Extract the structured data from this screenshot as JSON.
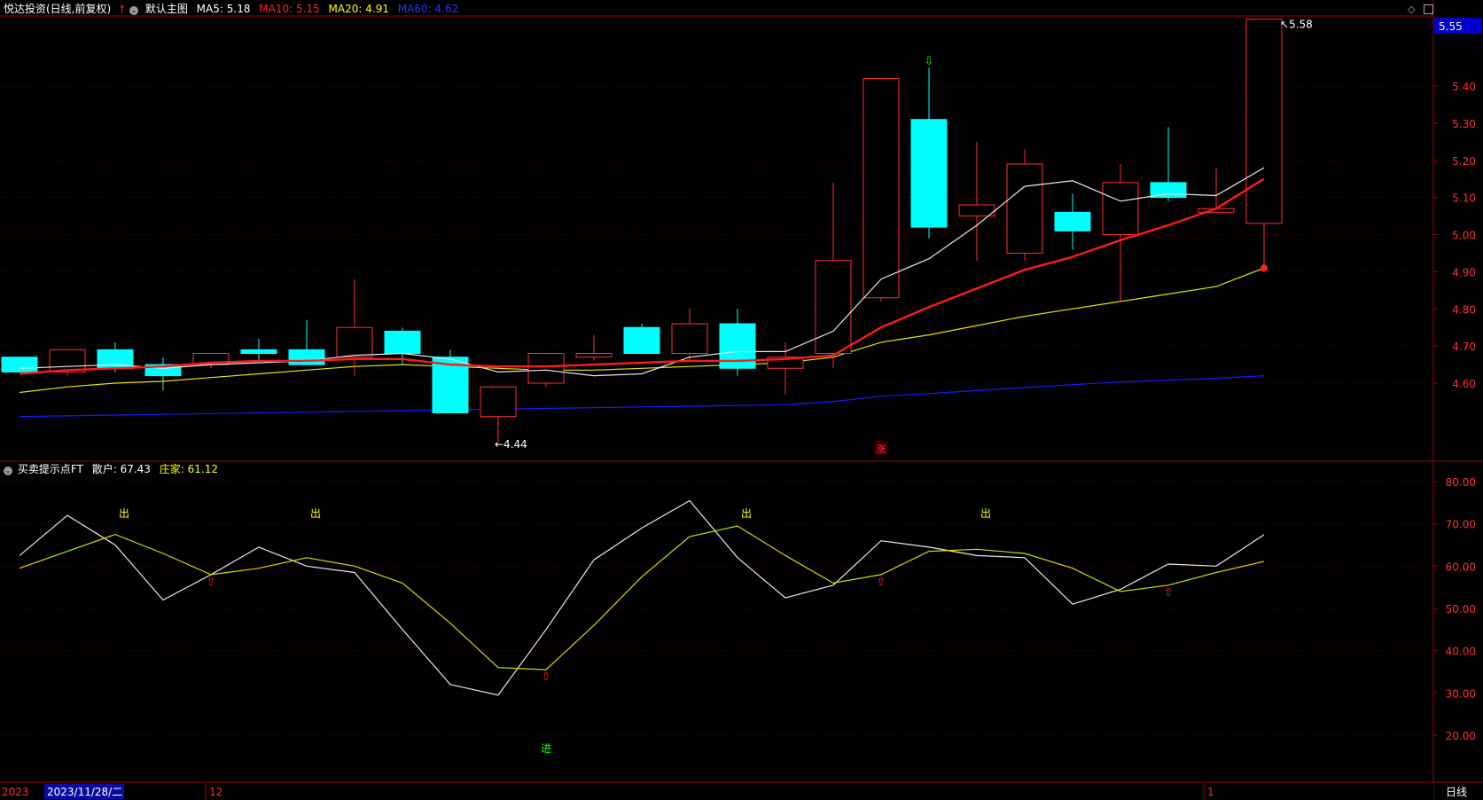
{
  "main_header": {
    "title": "悦达投资(日线,前复权)",
    "template": "默认主图",
    "ma5": {
      "label": "MA5:",
      "value": "5.18",
      "color": "#ffffff"
    },
    "ma10": {
      "label": "MA10:",
      "value": "5.15",
      "color": "#ff2020"
    },
    "ma20": {
      "label": "MA20:",
      "value": "4.91",
      "color": "#ffff00"
    },
    "ma60": {
      "label": "MA60:",
      "value": "4.62",
      "color": "#2020ff"
    }
  },
  "sub_header": {
    "title": "买卖提示点FT",
    "sanhu": {
      "label": "散户:",
      "value": "67.43",
      "color": "#ffffff"
    },
    "zhuangjia": {
      "label": "庄家:",
      "value": "61.12",
      "color": "#ffff00"
    }
  },
  "price_axis": {
    "current": "5.55",
    "ticks": [
      "5.40",
      "5.30",
      "5.20",
      "5.10",
      "5.00",
      "4.90",
      "4.80",
      "4.70",
      "4.60"
    ]
  },
  "indicator_axis": {
    "ticks": [
      "80.00",
      "70.00",
      "60.00",
      "50.00",
      "40.00",
      "30.00",
      "20.00"
    ]
  },
  "annotations": {
    "high": "5.58",
    "low": "4.44",
    "zhang": "涨",
    "chu": "出",
    "jin": "进"
  },
  "bottom_bar": {
    "year": "2023",
    "cursor_date": "2023/11/28/二",
    "month_12": "12",
    "month_1": "1",
    "period": "日线"
  },
  "colors": {
    "up": "#ff3030",
    "down": "#00ffff",
    "grid": "#800000",
    "axis_text": "#ff3030"
  },
  "chart_data": [
    {
      "type": "candlestick",
      "title": "悦达投资(日线,前复权)",
      "y_range": [
        4.4,
        5.6
      ],
      "candles": [
        {
          "o": 4.67,
          "h": 4.67,
          "l": 4.63,
          "c": 4.63
        },
        {
          "o": 4.63,
          "h": 4.69,
          "l": 4.62,
          "c": 4.69
        },
        {
          "o": 4.69,
          "h": 4.71,
          "l": 4.63,
          "c": 4.64
        },
        {
          "o": 4.65,
          "h": 4.67,
          "l": 4.58,
          "c": 4.62
        },
        {
          "o": 4.65,
          "h": 4.68,
          "l": 4.64,
          "c": 4.68
        },
        {
          "o": 4.69,
          "h": 4.72,
          "l": 4.66,
          "c": 4.68
        },
        {
          "o": 4.69,
          "h": 4.77,
          "l": 4.65,
          "c": 4.65
        },
        {
          "o": 4.67,
          "h": 4.88,
          "l": 4.62,
          "c": 4.75
        },
        {
          "o": 4.74,
          "h": 4.75,
          "l": 4.65,
          "c": 4.68
        },
        {
          "o": 4.67,
          "h": 4.69,
          "l": 4.52,
          "c": 4.52
        },
        {
          "o": 4.51,
          "h": 4.59,
          "l": 4.44,
          "c": 4.59
        },
        {
          "o": 4.6,
          "h": 4.68,
          "l": 4.59,
          "c": 4.68
        },
        {
          "o": 4.67,
          "h": 4.73,
          "l": 4.66,
          "c": 4.68
        },
        {
          "o": 4.75,
          "h": 4.76,
          "l": 4.68,
          "c": 4.68
        },
        {
          "o": 4.68,
          "h": 4.8,
          "l": 4.66,
          "c": 4.76
        },
        {
          "o": 4.76,
          "h": 4.8,
          "l": 4.62,
          "c": 4.64
        },
        {
          "o": 4.64,
          "h": 4.71,
          "l": 4.57,
          "c": 4.67
        },
        {
          "o": 4.68,
          "h": 5.14,
          "l": 4.64,
          "c": 4.93
        },
        {
          "o": 4.83,
          "h": 5.42,
          "l": 4.82,
          "c": 5.42
        },
        {
          "o": 5.31,
          "h": 5.45,
          "l": 4.99,
          "c": 5.02
        },
        {
          "o": 5.05,
          "h": 5.25,
          "l": 4.93,
          "c": 5.08
        },
        {
          "o": 4.95,
          "h": 5.23,
          "l": 4.93,
          "c": 5.19
        },
        {
          "o": 5.06,
          "h": 5.11,
          "l": 4.96,
          "c": 5.01
        },
        {
          "o": 5.0,
          "h": 5.19,
          "l": 4.82,
          "c": 5.14
        },
        {
          "o": 5.14,
          "h": 5.29,
          "l": 5.09,
          "c": 5.1
        },
        {
          "o": 5.06,
          "h": 5.18,
          "l": 5.06,
          "c": 5.07
        },
        {
          "o": 5.03,
          "h": 5.58,
          "l": 4.9,
          "c": 5.58
        }
      ],
      "ma5": [
        4.64,
        4.645,
        4.65,
        4.64,
        4.65,
        4.655,
        4.66,
        4.675,
        4.68,
        4.665,
        4.63,
        4.635,
        4.62,
        4.625,
        4.67,
        4.685,
        4.685,
        4.74,
        4.88,
        4.935,
        5.025,
        5.13,
        5.145,
        5.09,
        5.11,
        5.105,
        5.18
      ],
      "ma10": [
        4.625,
        4.635,
        4.64,
        4.645,
        4.655,
        4.66,
        4.66,
        4.665,
        4.665,
        4.65,
        4.645,
        4.645,
        4.65,
        4.655,
        4.66,
        4.66,
        4.665,
        4.675,
        4.75,
        4.805,
        4.855,
        4.905,
        4.94,
        4.985,
        5.025,
        5.07,
        5.15
      ],
      "ma20": [
        4.575,
        4.59,
        4.6,
        4.605,
        4.615,
        4.625,
        4.635,
        4.645,
        4.65,
        4.645,
        4.64,
        4.635,
        4.635,
        4.64,
        4.645,
        4.65,
        4.655,
        4.67,
        4.71,
        4.73,
        4.755,
        4.78,
        4.8,
        4.82,
        4.84,
        4.86,
        4.91
      ],
      "ma60": [
        4.51,
        4.512,
        4.514,
        4.516,
        4.518,
        4.52,
        4.522,
        4.524,
        4.526,
        4.528,
        4.53,
        4.532,
        4.534,
        4.536,
        4.538,
        4.54,
        4.542,
        4.55,
        4.565,
        4.572,
        4.58,
        4.588,
        4.596,
        4.603,
        4.608,
        4.613,
        4.62
      ],
      "high_label": 5.58,
      "low_label": 4.44
    },
    {
      "type": "line",
      "title": "买卖提示点FT",
      "y_range": [
        15,
        86
      ],
      "ticks": [
        20,
        30,
        40,
        50,
        60,
        70,
        80
      ],
      "series": [
        {
          "name": "散户",
          "color": "#ffffff",
          "values": [
            62.5,
            72,
            65,
            52,
            58,
            64.5,
            60,
            58.5,
            45,
            32,
            29.5,
            45,
            61.5,
            69,
            75.5,
            62,
            52.5,
            55.5,
            66,
            64.5,
            62.5,
            62,
            51,
            54.5,
            60.5,
            60,
            67.43
          ]
        },
        {
          "name": "庄家",
          "color": "#ffff00",
          "values": [
            59.5,
            63.5,
            67.5,
            63,
            58,
            59.5,
            62,
            60,
            56,
            46.5,
            36,
            35.5,
            46,
            57.5,
            67,
            69.5,
            62.5,
            56,
            58,
            63.5,
            64,
            63,
            59.5,
            54,
            55.5,
            58.5,
            61.12
          ]
        }
      ],
      "signals": {
        "chu": [
          2,
          6,
          15,
          20
        ],
        "buy_arrow": [
          4,
          11,
          18,
          24
        ],
        "jin": [
          11
        ]
      }
    }
  ]
}
